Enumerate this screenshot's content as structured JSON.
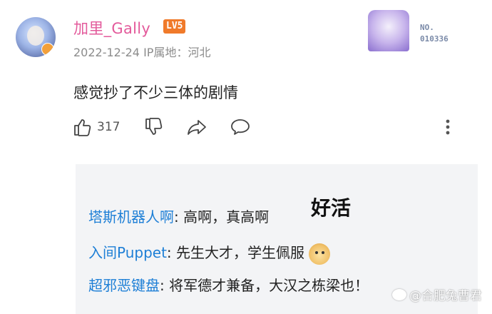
{
  "post": {
    "username": "加里_Gally",
    "level": "LV5",
    "date": "2022-12-24",
    "ip_location": "IP属地：河北",
    "comment": "感觉抄了不少三体的剧情",
    "like_count": "317"
  },
  "fan_badge": {
    "label_top": "NO.",
    "label_bottom": "010336"
  },
  "replies": [
    {
      "name": "塔斯机器人啊",
      "text": ": 高啊，真高啊"
    },
    {
      "name": "入间Puppet",
      "text": ": 先生大才，学生佩服"
    },
    {
      "name": "超邪恶键盘",
      "text": ": 将军德才兼备，大汉之栋梁也！"
    }
  ],
  "stickers": {
    "haohuo": "好活"
  },
  "watermark": "@合肥兔曹君",
  "icons": [
    "thumbs-up-icon",
    "thumbs-down-icon",
    "share-icon",
    "comment-icon",
    "more-vertical-icon",
    "doge-emoji-icon"
  ],
  "colors": {
    "username": "#e35a9b",
    "level_badge": "#f07a2a",
    "reply_name": "#1e7fd6",
    "reply_bg": "#f3f4f6"
  }
}
